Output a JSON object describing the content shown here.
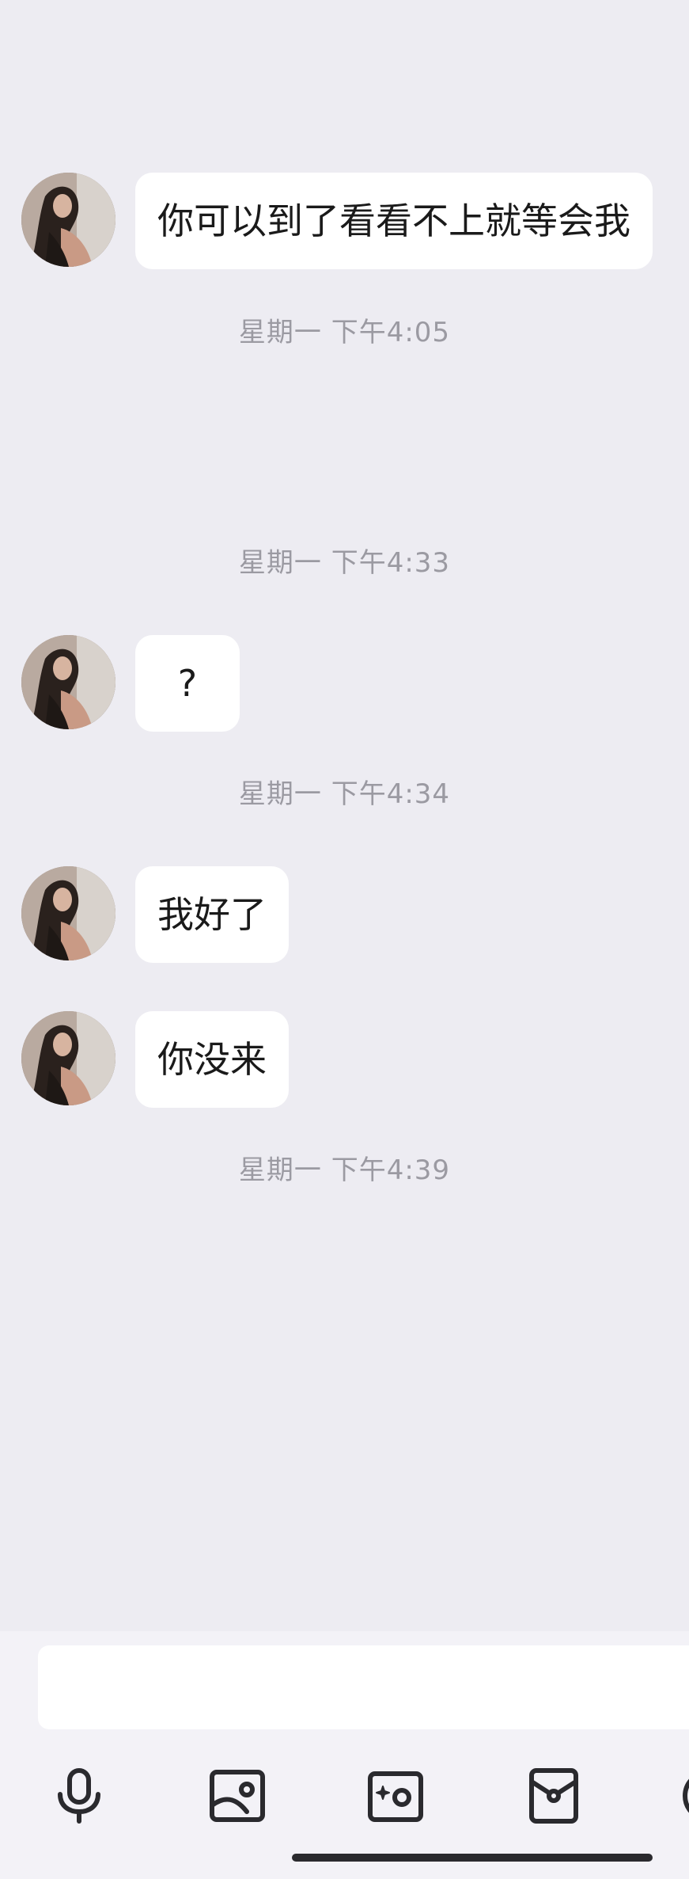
{
  "messages": [
    {
      "text": "你可以到了看看不上就等会我"
    },
    {
      "text": "?"
    },
    {
      "text": "我好了"
    },
    {
      "text": "你没来"
    }
  ],
  "timestamps": [
    "星期一 下午4:05",
    "星期一 下午4:33",
    "星期一 下午4:34",
    "星期一 下午4:39"
  ],
  "composer": {
    "input_value": "",
    "icons": [
      "microphone-icon",
      "image-icon",
      "camera-icon",
      "red-envelope-icon",
      "more-icon"
    ]
  },
  "colors": {
    "background": "#edecf2",
    "bubble": "#ffffff",
    "timestamp_text": "#9b9aa2",
    "message_text": "#1a1a1a",
    "icon_stroke": "#2a2a2e"
  }
}
